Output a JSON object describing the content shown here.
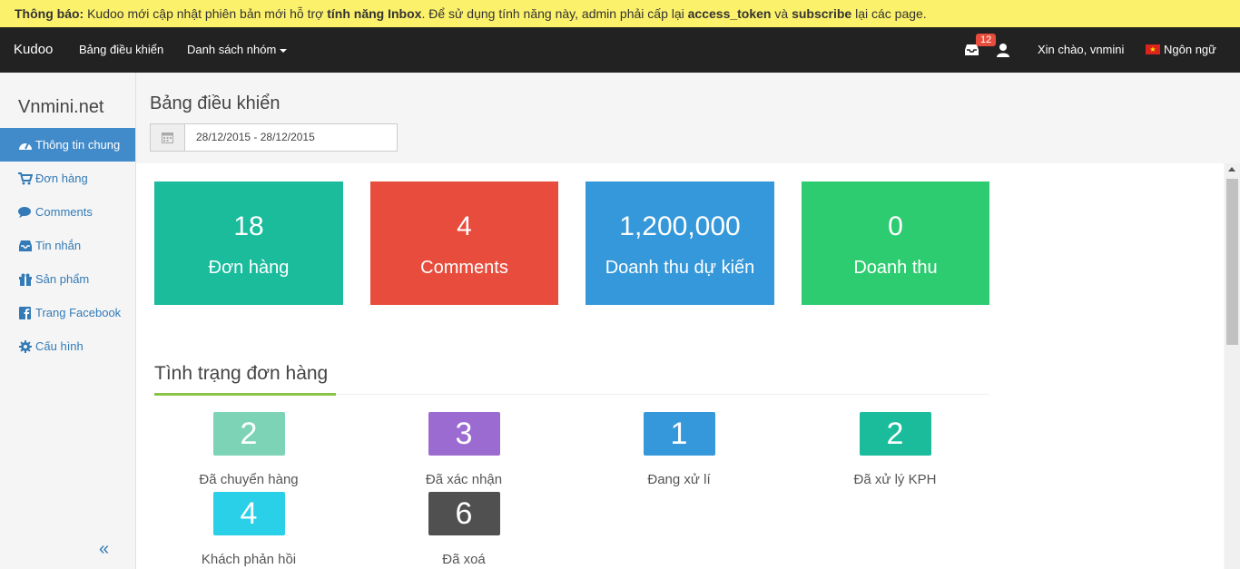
{
  "notice": {
    "label": "Thông báo:",
    "text1": " Kudoo mới cập nhật phiên bản mới hỗ trợ ",
    "bold1": "tính năng Inbox",
    "text2": ". Để sử dụng tính năng này, admin phải cấp lại ",
    "bold2": "access_token",
    "text3": " và ",
    "bold3": "subscribe",
    "text4": " lại các page."
  },
  "navbar": {
    "brand": "Kudoo",
    "dashboard": "Bảng điều khiển",
    "groups": "Danh sách nhóm",
    "inbox_count": "12",
    "greeting": "Xin chào, vnmini",
    "language": "Ngôn ngữ"
  },
  "sidebar": {
    "site": "Vnmini.net",
    "items": [
      {
        "label": "Thông tin chung",
        "icon": "dashboard-icon"
      },
      {
        "label": "Đơn hàng",
        "icon": "cart-icon"
      },
      {
        "label": "Comments",
        "icon": "comments-icon"
      },
      {
        "label": "Tin nhắn",
        "icon": "inbox-icon"
      },
      {
        "label": "Sản phẩm",
        "icon": "gift-icon"
      },
      {
        "label": "Trang Facebook",
        "icon": "facebook-icon"
      },
      {
        "label": "Cấu hình",
        "icon": "gear-icon"
      }
    ],
    "collapse": "«"
  },
  "header": {
    "title": "Bảng điều khiển",
    "date_range": "28/12/2015 - 28/12/2015"
  },
  "stats": [
    {
      "value": "18",
      "label": "Đơn hàng",
      "color": "#1abc9c"
    },
    {
      "value": "4",
      "label": "Comments",
      "color": "#e74c3c"
    },
    {
      "value": "1,200,000",
      "label": "Doanh thu dự kiến",
      "color": "#3498db"
    },
    {
      "value": "0",
      "label": "Doanh thu",
      "color": "#2ecc71"
    }
  ],
  "order_status": {
    "title": "Tình trạng đơn hàng",
    "items": [
      {
        "value": "2",
        "label": "Đã chuyển hàng",
        "color": "#7dd3b5"
      },
      {
        "value": "3",
        "label": "Đã xác nhận",
        "color": "#9b6bd1"
      },
      {
        "value": "1",
        "label": "Đang xử lí",
        "color": "#3498db"
      },
      {
        "value": "2",
        "label": "Đã xử lý KPH",
        "color": "#1abc9c"
      },
      {
        "value": "4",
        "label": "Khách phản hồi",
        "color": "#2ad0e8"
      },
      {
        "value": "6",
        "label": "Đã xoá",
        "color": "#505050"
      }
    ]
  }
}
